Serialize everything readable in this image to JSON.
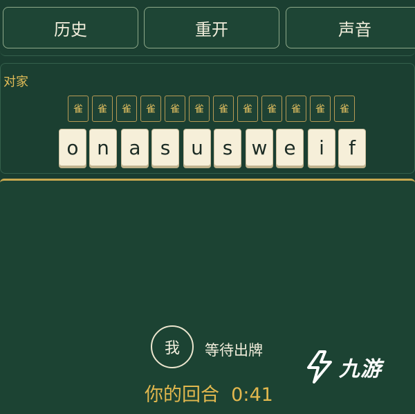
{
  "toolbar": {
    "history_label": "历史",
    "restart_label": "重开",
    "sound_label": "声音"
  },
  "opponent": {
    "label": "对家",
    "hidden_tiles": [
      "雀",
      "雀",
      "雀",
      "雀",
      "雀",
      "雀",
      "雀",
      "雀",
      "雀",
      "雀",
      "雀",
      "雀"
    ],
    "revealed_tiles": [
      "o",
      "n",
      "a",
      "s",
      "u",
      "s",
      "w",
      "e",
      "i",
      "f"
    ]
  },
  "player": {
    "avatar_label": "我",
    "status": "等待出牌",
    "turn_label": "你的回合",
    "timer": "0:41"
  },
  "watermark": {
    "text": "九游"
  },
  "colors": {
    "background": "#1a3d30",
    "gold_accent": "#e2b84e",
    "tile_face": "#f6efd9"
  }
}
